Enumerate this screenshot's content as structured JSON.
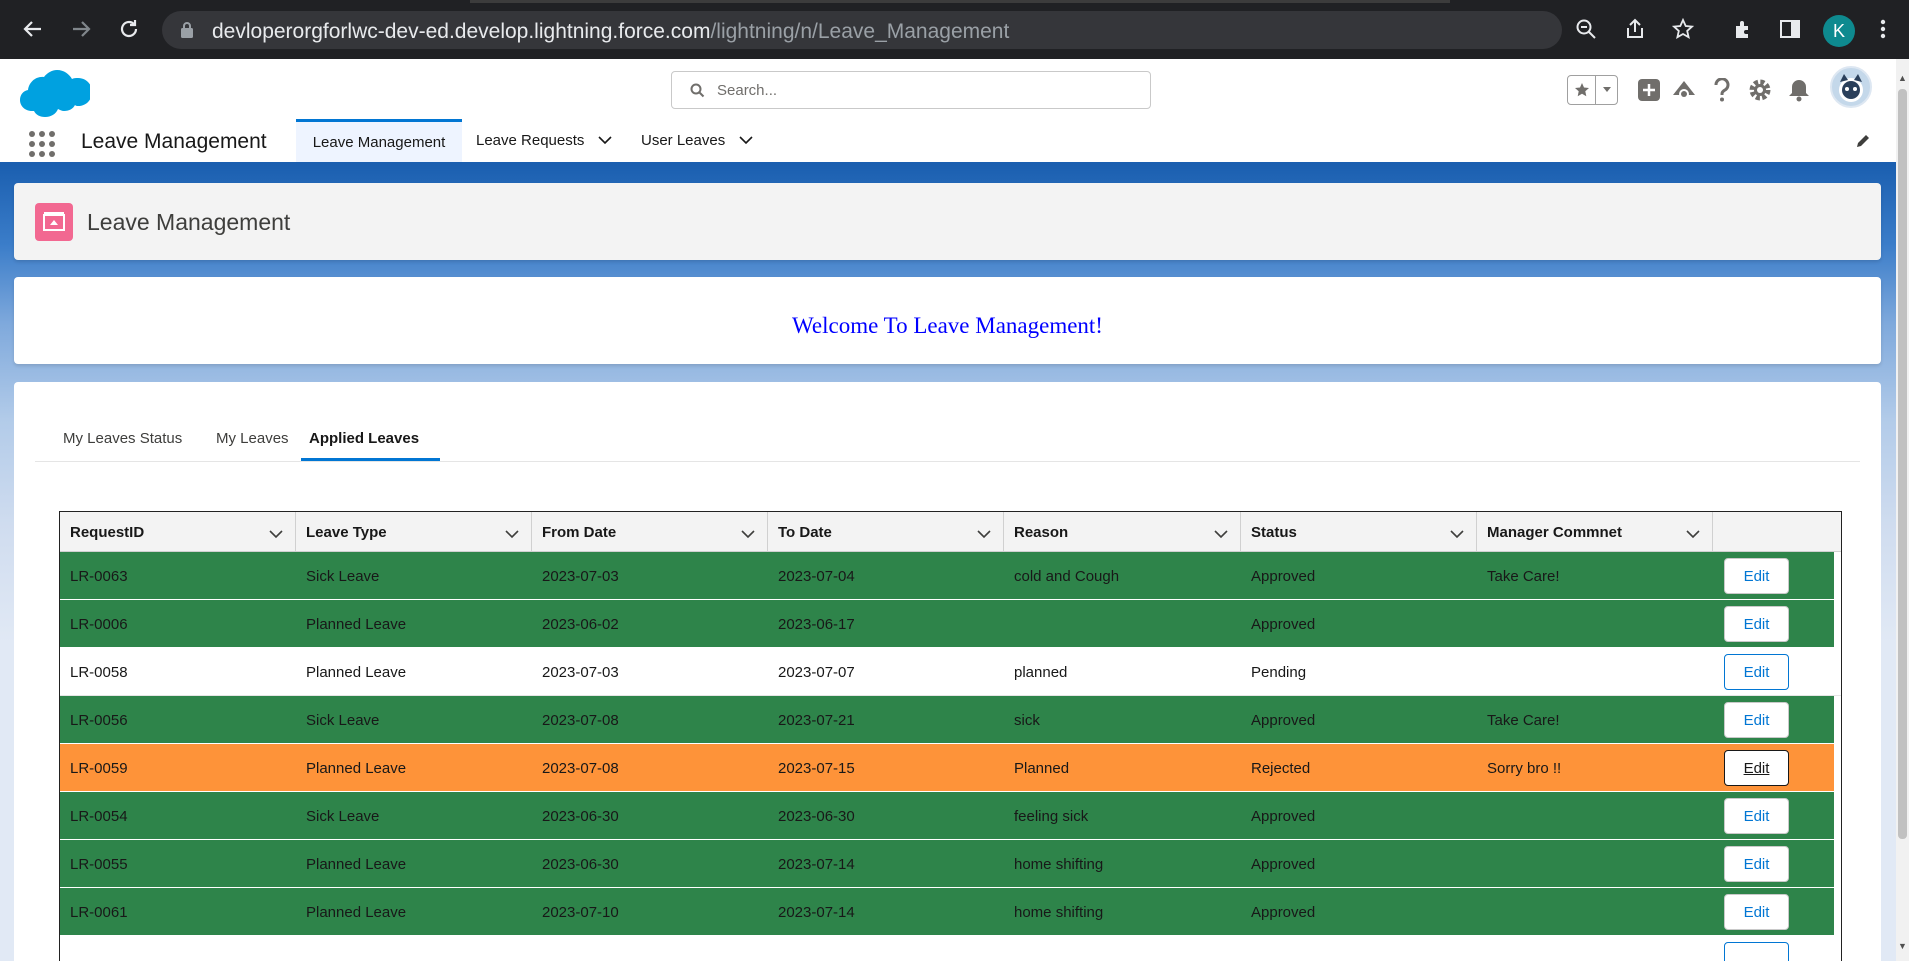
{
  "browser": {
    "url_host": "devloperorgforlwc-dev-ed.develop.lightning.force.com",
    "url_path": "/lightning/n/Leave_Management",
    "profile_initial": "K"
  },
  "header": {
    "search_placeholder": "Search..."
  },
  "appnav": {
    "app_name": "Leave Management",
    "tabs": [
      {
        "label": "Leave Management",
        "active": true
      },
      {
        "label": "Leave Requests",
        "active": false
      },
      {
        "label": "User Leaves",
        "active": false
      }
    ]
  },
  "page": {
    "title": "Leave Management",
    "welcome": "Welcome To Leave Management!"
  },
  "inner_tabs": [
    {
      "label": "My Leaves Status",
      "active": false
    },
    {
      "label": "My Leaves",
      "active": false
    },
    {
      "label": "Applied Leaves",
      "active": true
    }
  ],
  "table": {
    "columns": [
      "RequestID",
      "Leave Type",
      "From Date",
      "To Date",
      "Reason",
      "Status",
      "Manager Commnet"
    ],
    "edit_label": "Edit",
    "rows": [
      {
        "id": "LR-0063",
        "type": "Sick Leave",
        "from": "2023-07-03",
        "to": "2023-07-04",
        "reason": "cold and Cough",
        "status": "Approved",
        "comment": "Take Care!"
      },
      {
        "id": "LR-0006",
        "type": "Planned Leave",
        "from": "2023-06-02",
        "to": "2023-06-17",
        "reason": "",
        "status": "Approved",
        "comment": ""
      },
      {
        "id": "LR-0058",
        "type": "Planned Leave",
        "from": "2023-07-03",
        "to": "2023-07-07",
        "reason": "planned",
        "status": "Pending",
        "comment": ""
      },
      {
        "id": "LR-0056",
        "type": "Sick Leave",
        "from": "2023-07-08",
        "to": "2023-07-21",
        "reason": "sick",
        "status": "Approved",
        "comment": "Take Care!"
      },
      {
        "id": "LR-0059",
        "type": "Planned Leave",
        "from": "2023-07-08",
        "to": "2023-07-15",
        "reason": "Planned",
        "status": "Rejected",
        "comment": "Sorry bro !!"
      },
      {
        "id": "LR-0054",
        "type": "Sick Leave",
        "from": "2023-06-30",
        "to": "2023-06-30",
        "reason": "feeling sick",
        "status": "Approved",
        "comment": ""
      },
      {
        "id": "LR-0055",
        "type": "Planned Leave",
        "from": "2023-06-30",
        "to": "2023-07-14",
        "reason": "home shifting",
        "status": "Approved",
        "comment": ""
      },
      {
        "id": "LR-0061",
        "type": "Planned Leave",
        "from": "2023-07-10",
        "to": "2023-07-14",
        "reason": "home shifting",
        "status": "Approved",
        "comment": ""
      }
    ]
  },
  "colors": {
    "approved": "#2e844a",
    "rejected": "#fe9339",
    "pending": "#ffffff",
    "brand": "#0176d3"
  }
}
